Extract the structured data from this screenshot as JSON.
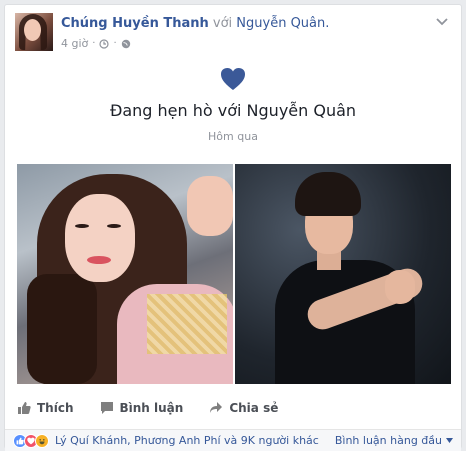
{
  "post": {
    "author": "Chúng Huyền Thanh",
    "with_word": "với",
    "tagged": "Nguyễn Quân.",
    "time": "4 giờ",
    "icons": [
      "clock-icon",
      "globe-icon",
      "chevron-down-icon"
    ]
  },
  "life_event": {
    "icon": "heart-icon",
    "title": "Đang hẹn hò với Nguyễn Quân",
    "date": "Hôm qua"
  },
  "actions": {
    "like": "Thích",
    "comment": "Bình luận",
    "share": "Chia sẻ"
  },
  "reactions": {
    "icons": [
      "like-reaction-icon",
      "love-reaction-icon",
      "haha-reaction-icon"
    ],
    "summary": "Lý Quí Khánh, Phương Anh Phí và 9K người khác",
    "sort_label": "Bình luận hàng đầu"
  },
  "colors": {
    "link": "#365899",
    "heart": "#3b5998",
    "meta": "#90949c"
  }
}
